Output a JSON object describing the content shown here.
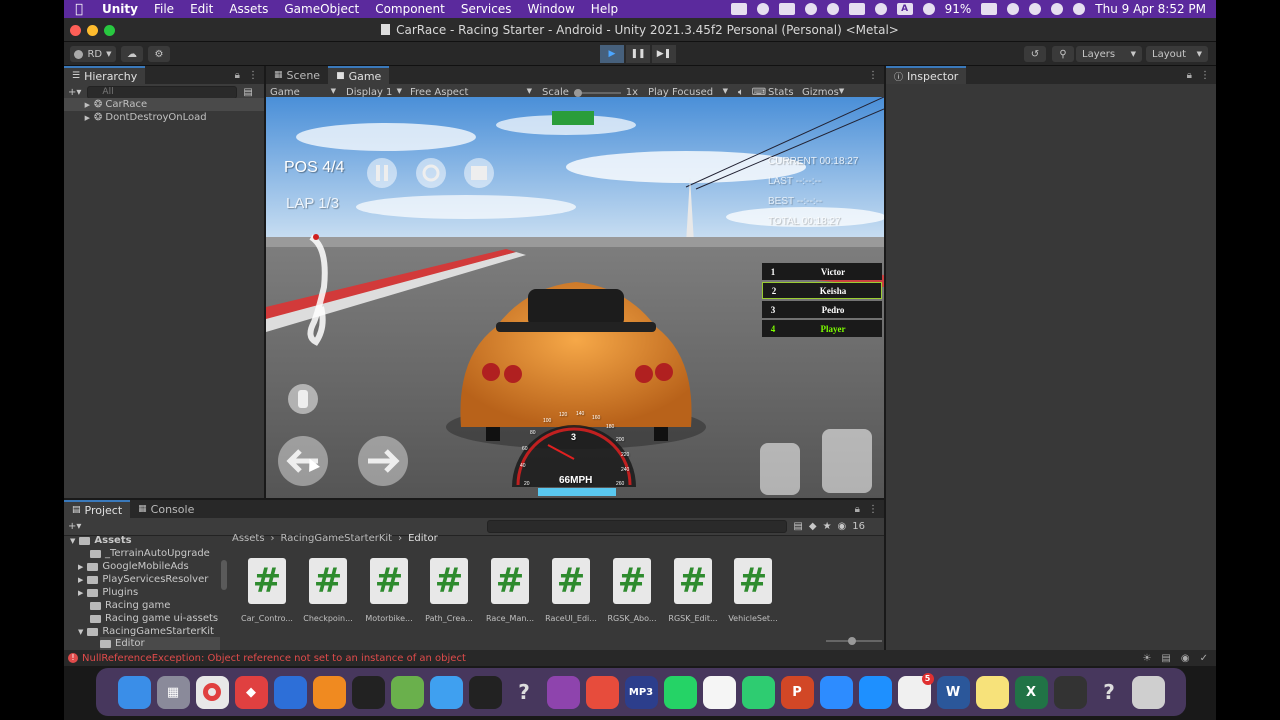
{
  "menubar": {
    "app": "Unity",
    "items": [
      "File",
      "Edit",
      "Assets",
      "GameObject",
      "Component",
      "Services",
      "Window",
      "Help"
    ],
    "battery": "91%",
    "datetime": "Thu 9 Apr  8:52 PM",
    "input_badge": "A"
  },
  "window": {
    "title": "CarRace - Racing Starter - Android - Unity 2021.3.45f2 Personal (Personal) <Metal>"
  },
  "toolbar": {
    "account": "RD",
    "layers": "Layers",
    "layout": "Layout"
  },
  "hierarchy": {
    "tab": "Hierarchy",
    "search_placeholder": "All",
    "items": [
      "CarRace",
      "DontDestroyOnLoad"
    ]
  },
  "scene_tabs": {
    "scene": "Scene",
    "game": "Game"
  },
  "game_bar": {
    "mode": "Game",
    "display": "Display 1",
    "aspect": "Free Aspect",
    "scale_label": "Scale",
    "scale_value": "1x",
    "play_mode": "Play Focused",
    "stats": "Stats",
    "gizmos": "Gizmos"
  },
  "hud": {
    "position": "POS 4/4",
    "lap": "LAP 1/3",
    "current": "CURRENT 00:18:27",
    "last": "LAST --:--:--",
    "best": "BEST --:--:--",
    "total": "TOTAL 00:18:27",
    "speed": "66MPH",
    "gear": "3",
    "speedo_ticks": [
      "20",
      "40",
      "60",
      "80",
      "100",
      "120",
      "140",
      "160",
      "180",
      "200",
      "220",
      "240",
      "260"
    ],
    "leaderboard": [
      {
        "pos": "1",
        "name": "Victor"
      },
      {
        "pos": "2",
        "name": "Keisha"
      },
      {
        "pos": "3",
        "name": "Pedro"
      },
      {
        "pos": "4",
        "name": "Player"
      }
    ]
  },
  "inspector": {
    "tab": "Inspector"
  },
  "project": {
    "tab": "Project",
    "console_tab": "Console",
    "count": "16",
    "breadcrumb": [
      "Assets",
      "RacingGameStarterKit",
      "Editor"
    ],
    "tree": {
      "root": "Assets",
      "children": [
        "_TerrainAutoUpgrade",
        "GoogleMobileAds",
        "PlayServicesResolver",
        "Plugins",
        "Racing game",
        "Racing game ui-assets",
        "RacingGameStarterKit"
      ],
      "sub": "Editor"
    },
    "files": [
      "Car_Contro...",
      "Checkpoin...",
      "Motorbike...",
      "Path_Crea...",
      "Race_Man...",
      "RaceUI_Edi...",
      "RGSK_Abo...",
      "RGSK_Edit...",
      "VehicleSet..."
    ]
  },
  "status": {
    "error": "NullReferenceException: Object reference not set to an instance of an object"
  },
  "dock": {
    "apps": [
      "finder-icon",
      "launchpad-icon",
      "chrome-icon",
      "git-icon",
      "xcode-icon",
      "blender-icon",
      "activity-monitor-icon",
      "android-studio-icon",
      "safari-icon",
      "unity-hub-icon",
      "help-icon",
      "visual-studio-icon",
      "sourcetree-icon",
      "mp3-icon",
      "whatsapp-icon",
      "freeform-icon",
      "spreadsheet-icon",
      "powerpoint-icon",
      "zoom-icon",
      "app-store-icon",
      "photos-icon",
      "word-icon",
      "notes-icon",
      "excel-icon",
      "unity-icon",
      "help-icon",
      "trash-icon"
    ],
    "labels": {
      "mp3": "MP3",
      "word": "W",
      "excel": "X",
      "powerpoint": "P",
      "question": "?"
    },
    "badge": "5"
  },
  "colors": {
    "accent": "#3a79bb",
    "menubar": "#5b2a9d",
    "error": "#e04b4b",
    "car": "#e08a2a"
  }
}
